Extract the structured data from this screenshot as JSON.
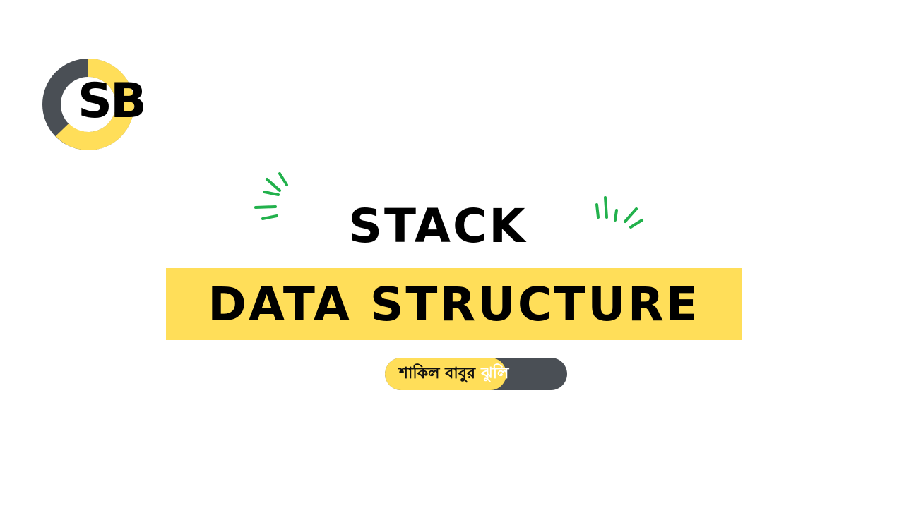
{
  "logo": {
    "text": "SB"
  },
  "heading": {
    "line1": "STACK",
    "line2": "DATA STRUCTURE"
  },
  "tag": {
    "part1": "শাকিল বাবুর",
    "part2": "ঝুলি"
  },
  "colors": {
    "yellow": "#ffde59",
    "dark": "#4a4f55",
    "accent": "#22b14c"
  }
}
